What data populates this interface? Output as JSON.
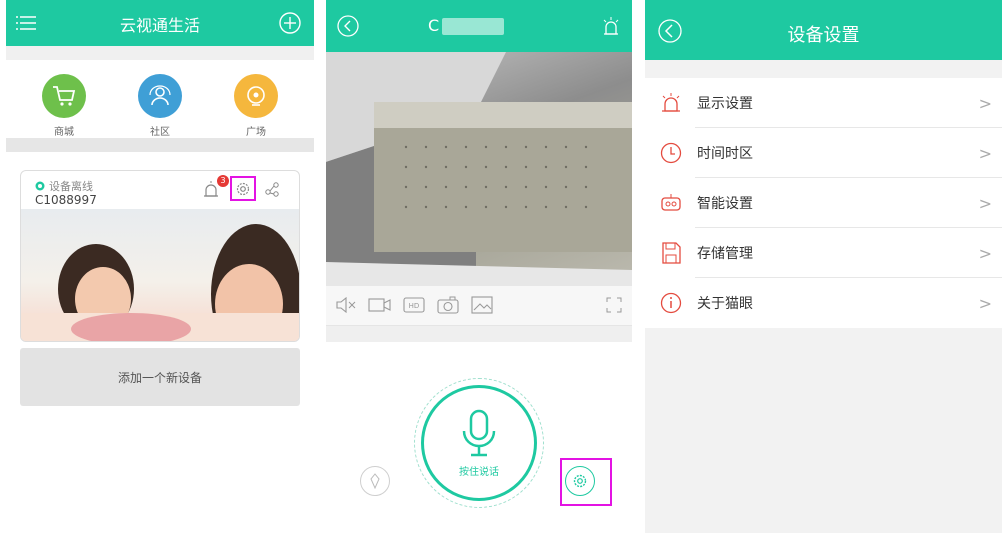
{
  "colors": {
    "accent": "#1ec9a1",
    "highlight": "#e313e3"
  },
  "home": {
    "title": "云视通生活",
    "categories": [
      {
        "label": "商城",
        "icon": "cart-icon",
        "color": "#6ec04b"
      },
      {
        "label": "社区",
        "icon": "community-icon",
        "color": "#3f9fd6"
      },
      {
        "label": "广场",
        "icon": "plaza-icon",
        "color": "#f5b73d"
      }
    ],
    "device": {
      "status": "设备离线",
      "id": "C1088997",
      "badge": "3"
    },
    "add_device_label": "添加一个新设备"
  },
  "player": {
    "title": "C",
    "talk_label": "按住说话"
  },
  "settings": {
    "title": "设备设置",
    "items": [
      {
        "label": "显示设置",
        "icon": "alarm-light-icon"
      },
      {
        "label": "时间时区",
        "icon": "clock-icon"
      },
      {
        "label": "智能设置",
        "icon": "robot-icon"
      },
      {
        "label": "存储管理",
        "icon": "save-icon"
      },
      {
        "label": "关于猫眼",
        "icon": "info-icon"
      }
    ],
    "arrow": ">"
  }
}
